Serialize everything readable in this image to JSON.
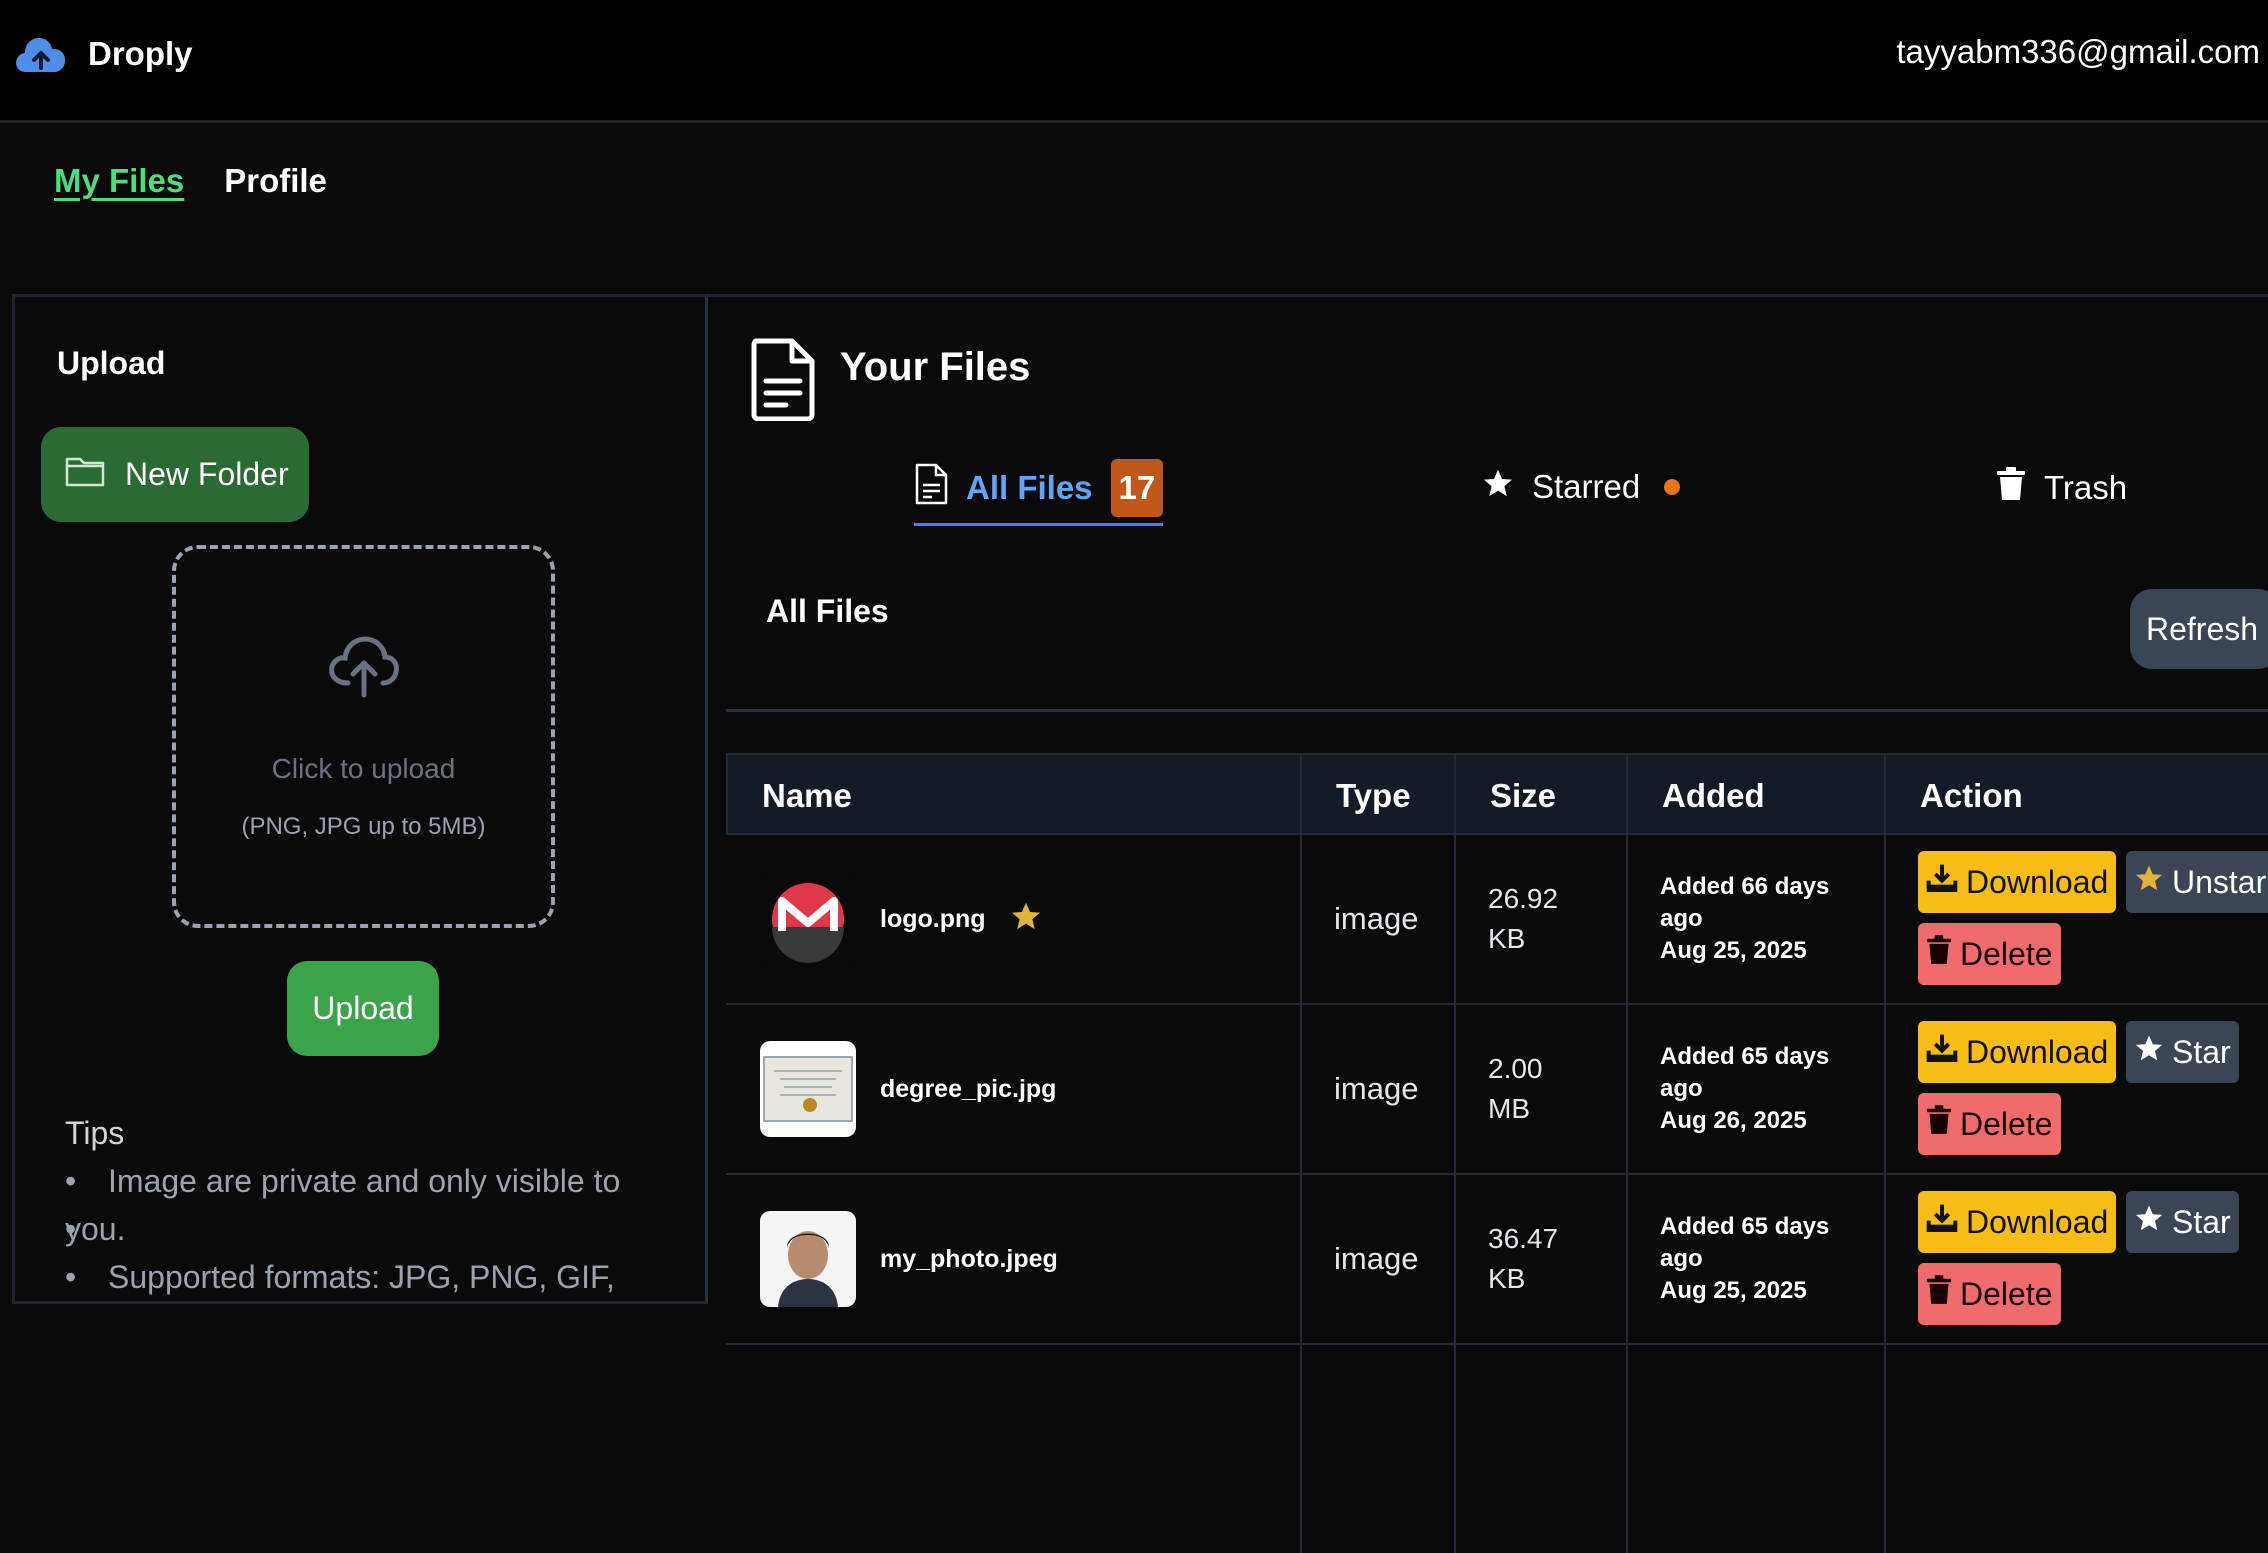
{
  "app": {
    "name": "Droply",
    "user_email": "tayyabm336@gmail.com"
  },
  "nav": {
    "my_files": "My Files",
    "profile": "Profile"
  },
  "upload_panel": {
    "title": "Upload",
    "new_folder": "New Folder",
    "dropzone_text": "Click to upload",
    "dropzone_sub": "(PNG, JPG up to 5MB)",
    "upload_button": "Upload",
    "tips_title": "Tips",
    "tips": [
      "Image are private and only visible to",
      "you.",
      "Supported formats: JPG, PNG, GIF,"
    ]
  },
  "files": {
    "title": "Your Files",
    "tabs": {
      "all": "All Files",
      "all_count": "17",
      "starred": "Starred",
      "trash": "Trash"
    },
    "section_title": "All Files",
    "refresh": "Refresh",
    "columns": [
      "Name",
      "Type",
      "Size",
      "Added",
      "Action"
    ],
    "rows": [
      {
        "name": "logo.png",
        "type": "image",
        "size_1": "26.92",
        "size_2": "KB",
        "added_1": "Added 66 days",
        "added_2": "ago",
        "added_3": "Aug 25, 2025",
        "star_label": "Unstar",
        "starred": true
      },
      {
        "name": "degree_pic.jpg",
        "type": "image",
        "size_1": "2.00",
        "size_2": "MB",
        "added_1": "Added 65 days",
        "added_2": "ago",
        "added_3": "Aug 26, 2025",
        "star_label": "Star",
        "starred": false
      },
      {
        "name": "my_photo.jpeg",
        "type": "image",
        "size_1": "36.47",
        "size_2": "KB",
        "added_1": "Added 65 days",
        "added_2": "ago",
        "added_3": "Aug 25, 2025",
        "star_label": "Star",
        "starred": false
      }
    ],
    "download": "Download",
    "delete": "Delete"
  },
  "colors": {
    "accent_green": "#4ade80",
    "accent_blue": "#60a5fa",
    "badge_orange": "#c2571a",
    "download_yellow": "#f6bd16",
    "delete_red": "#f06b6b"
  }
}
